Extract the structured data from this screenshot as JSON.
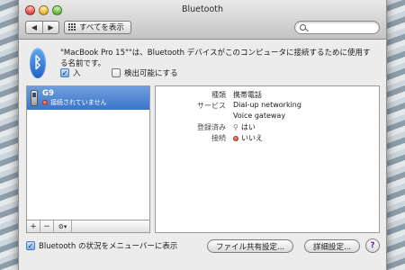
{
  "window": {
    "title": "Bluetooth",
    "show_all_label": "すべてを表示",
    "search_placeholder": ""
  },
  "header": {
    "description": "\"MacBook Pro 15\"\"は、Bluetooth デバイスがこのコンピュータに接続するために使用する名前です。",
    "power_checkbox": {
      "label": "入",
      "checked": true
    },
    "discoverable_checkbox": {
      "label": "検出可能にする",
      "checked": false
    }
  },
  "devices": [
    {
      "name": "G9",
      "status": "接続されていません",
      "status_color": "#d4281d",
      "selected": true
    }
  ],
  "list_toolbar": {
    "add": "+",
    "remove": "−",
    "gear": "⚙▾"
  },
  "details": {
    "type_key": "種類",
    "type_value": "携帯電話",
    "services_key": "サービス",
    "services_values": [
      "Dial-up networking",
      "Voice gateway"
    ],
    "paired_key": "登録済み",
    "paired_value": "はい",
    "connected_key": "接続",
    "connected_value": "いいえ"
  },
  "footer": {
    "menubar_checkbox": {
      "label": "Bluetooth の状況をメニューバーに表示",
      "checked": true
    },
    "file_sharing_button": "ファイル共有設定...",
    "advanced_button": "詳細設定...",
    "help_label": "?"
  },
  "colors": {
    "selection": "#3a75c9",
    "accent": "#1f63c9",
    "disconnected": "#d4281d"
  }
}
